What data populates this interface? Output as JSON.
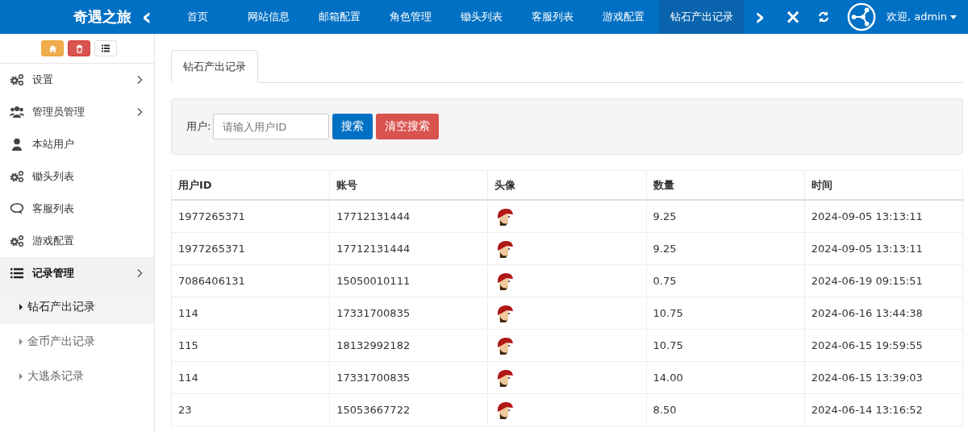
{
  "header": {
    "brand": "奇遇之旅",
    "prev": "‹",
    "next": "›",
    "close": "×",
    "user": "欢迎, admin"
  },
  "nav_tabs": [
    {
      "label": "首页",
      "selected": false
    },
    {
      "label": "网站信息",
      "selected": false
    },
    {
      "label": "邮箱配置",
      "selected": false
    },
    {
      "label": "角色管理",
      "selected": false
    },
    {
      "label": "锄头列表",
      "selected": false
    },
    {
      "label": "客服列表",
      "selected": false
    },
    {
      "label": "游戏配置",
      "selected": false
    },
    {
      "label": "钻石产出记录",
      "selected": true
    }
  ],
  "sidebar": {
    "tools": [
      {
        "kind": "home"
      },
      {
        "kind": "trash"
      },
      {
        "kind": "list"
      }
    ],
    "items": [
      {
        "label": "设置",
        "kind": "gears",
        "expanded": false,
        "has_arrow": true
      },
      {
        "label": "管理员管理",
        "kind": "users",
        "expanded": false,
        "has_arrow": true
      },
      {
        "label": "本站用户",
        "kind": "user",
        "expanded": false,
        "has_arrow": false
      },
      {
        "label": "锄头列表",
        "kind": "gears",
        "expanded": false,
        "has_arrow": false
      },
      {
        "label": "客服列表",
        "kind": "chat",
        "expanded": false,
        "has_arrow": false
      },
      {
        "label": "游戏配置",
        "kind": "gears",
        "expanded": false,
        "has_arrow": false
      },
      {
        "label": "记录管理",
        "kind": "list",
        "expanded": true,
        "has_arrow": true,
        "children": [
          {
            "label": "钻石产出记录",
            "selected": true
          },
          {
            "label": "金币产出记录",
            "selected": false
          },
          {
            "label": "大逃杀记录",
            "selected": false
          }
        ]
      }
    ]
  },
  "page_tab": "钻石产出记录",
  "search": {
    "label": "用户:",
    "placeholder": "请输入用户ID",
    "search_button": "搜索",
    "clear_button": "清空搜索"
  },
  "table": {
    "columns": [
      "用户ID",
      "账号",
      "头像",
      "数量",
      "时间"
    ],
    "rows": [
      {
        "user_id": "1977265371",
        "account": "17712131444",
        "amount": "9.25",
        "time": "2024-09-05 13:13:11"
      },
      {
        "user_id": "1977265371",
        "account": "17712131444",
        "amount": "9.25",
        "time": "2024-09-05 13:13:11"
      },
      {
        "user_id": "7086406131",
        "account": "15050010111",
        "amount": "0.75",
        "time": "2024-06-19 09:15:51"
      },
      {
        "user_id": "114",
        "account": "17331700835",
        "amount": "10.75",
        "time": "2024-06-16 13:44:38"
      },
      {
        "user_id": "115",
        "account": "18132992182",
        "amount": "10.75",
        "time": "2024-06-15 19:59:55"
      },
      {
        "user_id": "114",
        "account": "17331700835",
        "amount": "14.00",
        "time": "2024-06-15 13:39:03"
      },
      {
        "user_id": "23",
        "account": "15053667722",
        "amount": "8.50",
        "time": "2024-06-14 13:16:52"
      }
    ]
  }
}
